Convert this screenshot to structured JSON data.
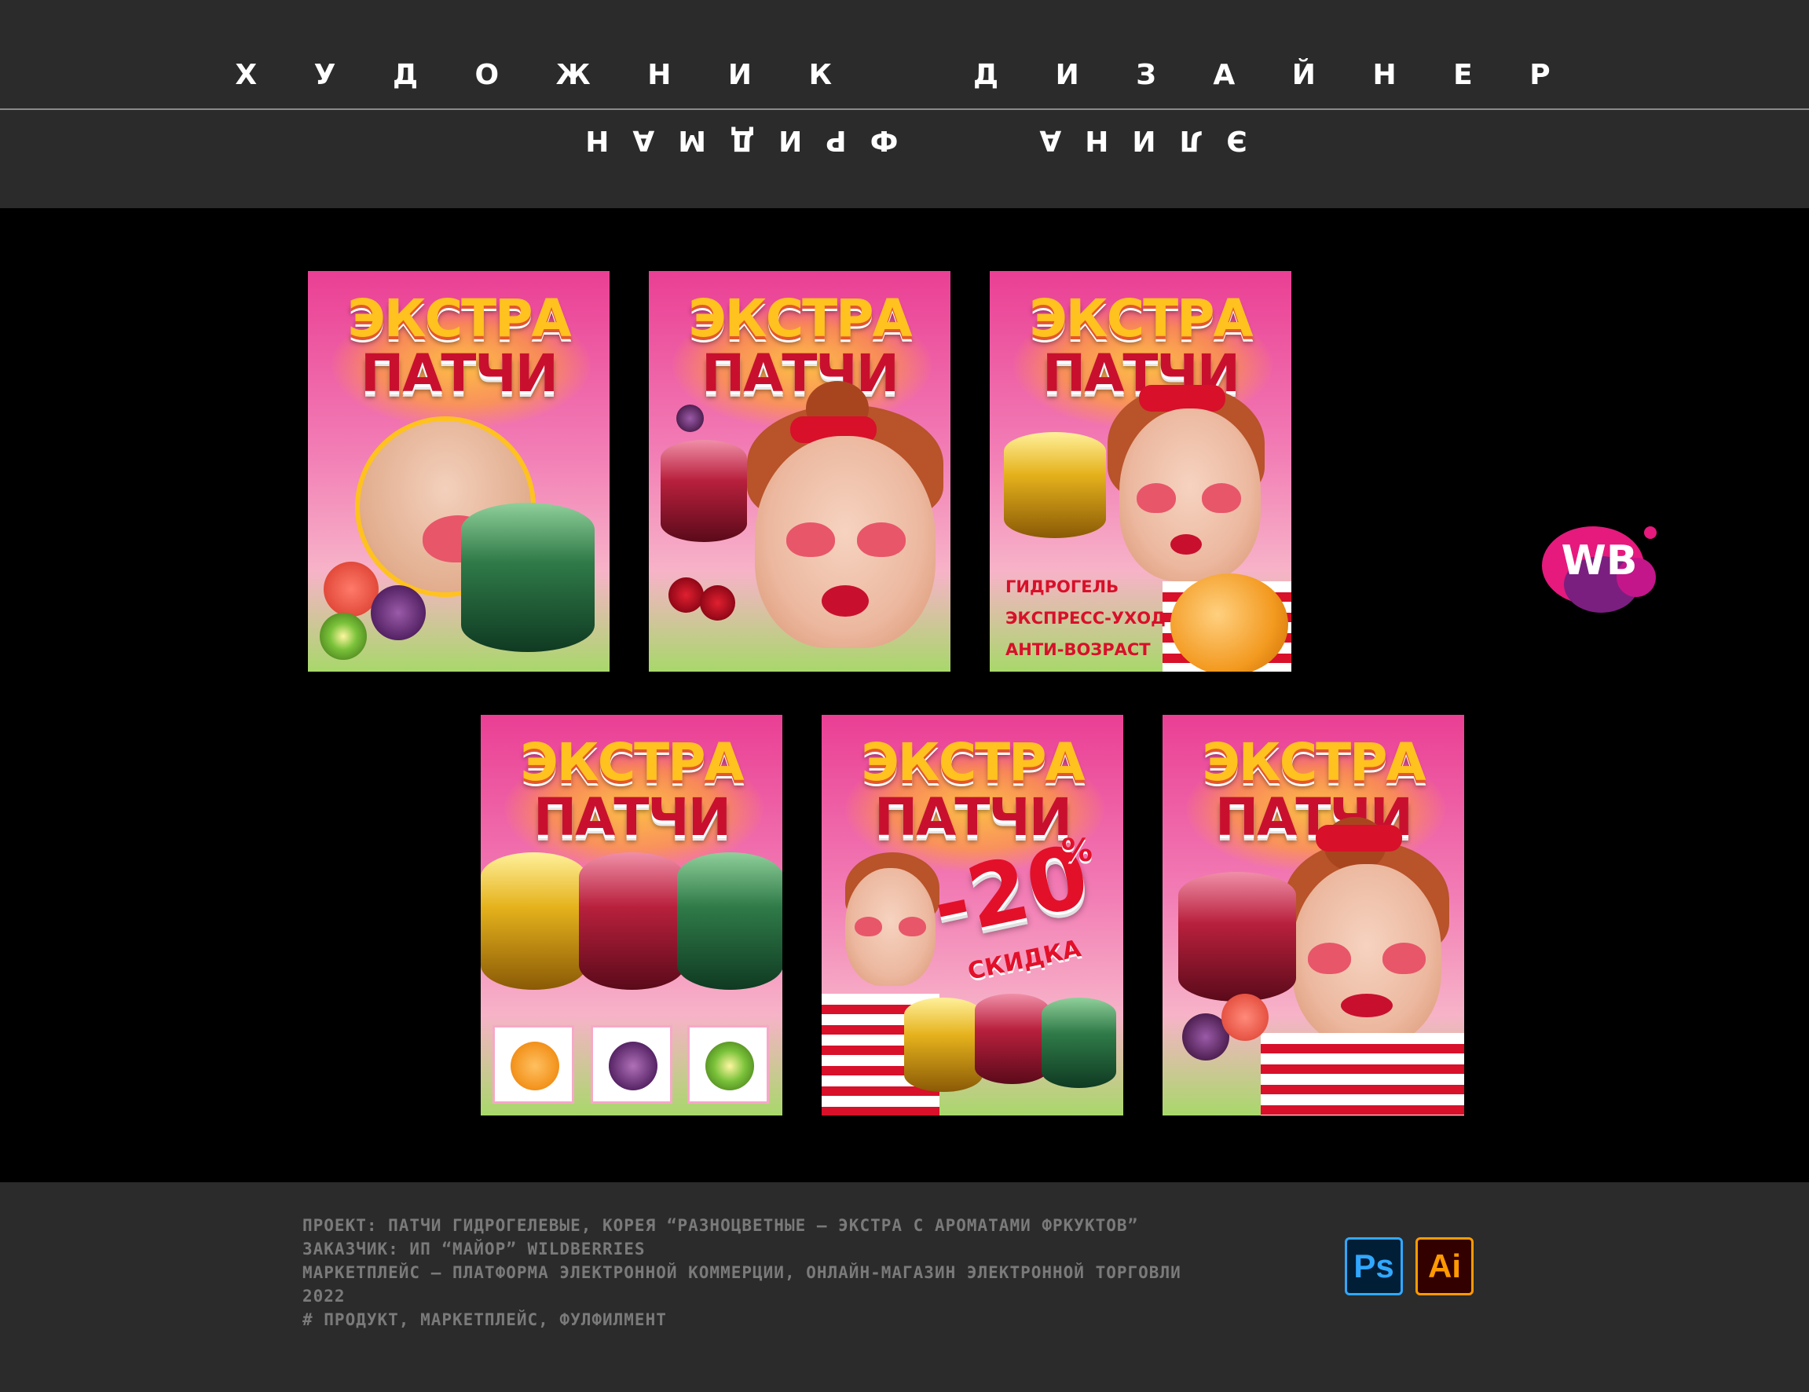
{
  "header": {
    "role_artist": "Х У Д О Ж Н И К",
    "role_designer": "Д И З А Й Н Е Р",
    "surname": "ФРИДМАН",
    "name": "ЭЛИНА"
  },
  "cards": [
    {
      "title1": "ЭКСТРА",
      "title2": "ПАТЧИ"
    },
    {
      "title1": "ЭКСТРА",
      "title2": "ПАТЧИ"
    },
    {
      "title1": "ЭКСТРА",
      "title2": "ПАТЧИ",
      "features": [
        "ГИДРОГЕЛЬ",
        "ЭКСПРЕСС-УХОД",
        "АНТИ-ВОЗРАСТ"
      ]
    },
    {
      "title1": "ЭКСТРА",
      "title2": "ПАТЧИ"
    },
    {
      "title1": "ЭКСТРА",
      "title2": "ПАТЧИ",
      "discount": "-20",
      "percent": "%",
      "sale_label": "СКИДКА"
    },
    {
      "title1": "ЭКСТРА",
      "title2": "ПАТЧИ"
    }
  ],
  "logo": {
    "label": "WB",
    "colors": {
      "magenta": "#e6197d",
      "purple": "#7a1f7f",
      "pink": "#c3168a"
    }
  },
  "footer": {
    "lines": [
      "ПРОЕКТ: ПАТЧИ ГИДРОГЕЛЕВЫЕ, КОРЕЯ “РАЗНОЦВЕТНЫЕ — ЭКСТРА С АРОМАТАМИ ФРКУКТОВ”",
      "ЗАКАЗЧИК:  ИП “МАЙОР” WILDBERRIES",
      "МАРКЕТПЛЕЙС — ПЛАТФОРМА ЭЛЕКТРОННОЙ КОММЕРЦИИ, ОНЛАЙН-МАГАЗИН ЭЛЕКТРОННОЙ ТОРГОВЛИ",
      "2022",
      "#  ПРОДУКТ, МАРКЕТПЛЕЙС, ФУЛФИЛМЕНТ"
    ],
    "apps": {
      "photoshop": "Ps",
      "illustrator": "Ai"
    },
    "app_icons": [
      "photoshop-icon",
      "illustrator-icon"
    ]
  }
}
